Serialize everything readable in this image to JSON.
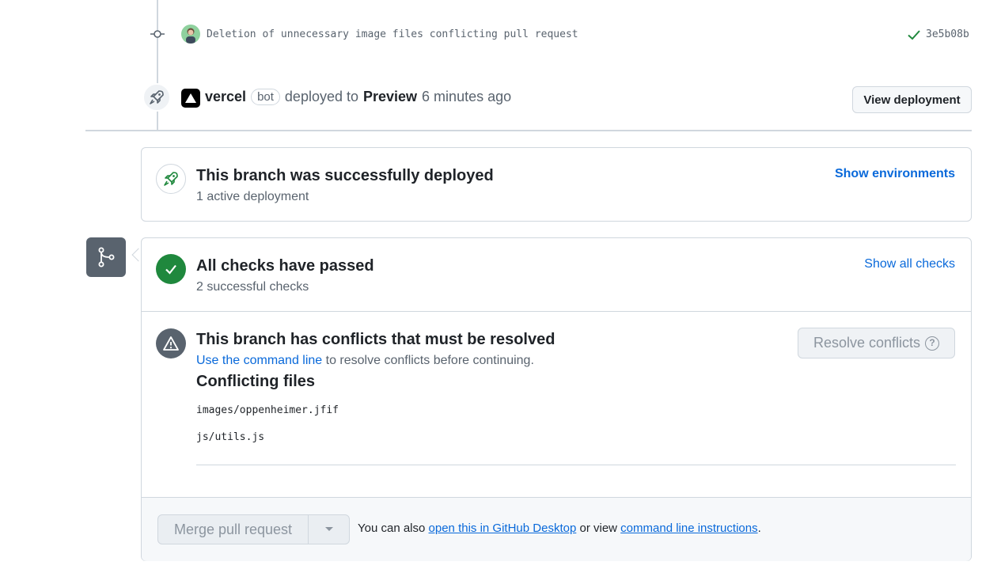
{
  "commit": {
    "message": "Deletion of unnecessary image files conflicting pull request",
    "sha": "3e5b08b"
  },
  "deployment_event": {
    "actor": "vercel",
    "badge": "bot",
    "action": "deployed to",
    "environment": "Preview",
    "time": "6 minutes ago",
    "view_button": "View deployment"
  },
  "deploy_status": {
    "title": "This branch was successfully deployed",
    "subtitle": "1 active deployment",
    "link": "Show environments"
  },
  "checks": {
    "title": "All checks have passed",
    "subtitle": "2 successful checks",
    "link": "Show all checks"
  },
  "conflicts": {
    "title": "This branch has conflicts that must be resolved",
    "hint_link": "Use the command line",
    "hint_text": " to resolve conflicts before continuing.",
    "resolve_button": "Resolve conflicts",
    "files_heading": "Conflicting files",
    "files": [
      "images/oppenheimer.jfif",
      "js/utils.js"
    ]
  },
  "merge": {
    "button": "Merge pull request",
    "text_prefix": "You can also ",
    "desktop_link": "open this in GitHub Desktop",
    "text_mid": " or view ",
    "cli_link": "command line instructions",
    "text_suffix": "."
  },
  "colors": {
    "success": "#1f883d",
    "link": "#0969da",
    "muted": "#59636e",
    "border": "#d0d7de"
  },
  "icons": [
    "commit-icon",
    "check-icon",
    "rocket-icon",
    "vercel-logo-icon",
    "git-merge-icon",
    "alert-icon",
    "question-icon",
    "caret-down-icon"
  ]
}
